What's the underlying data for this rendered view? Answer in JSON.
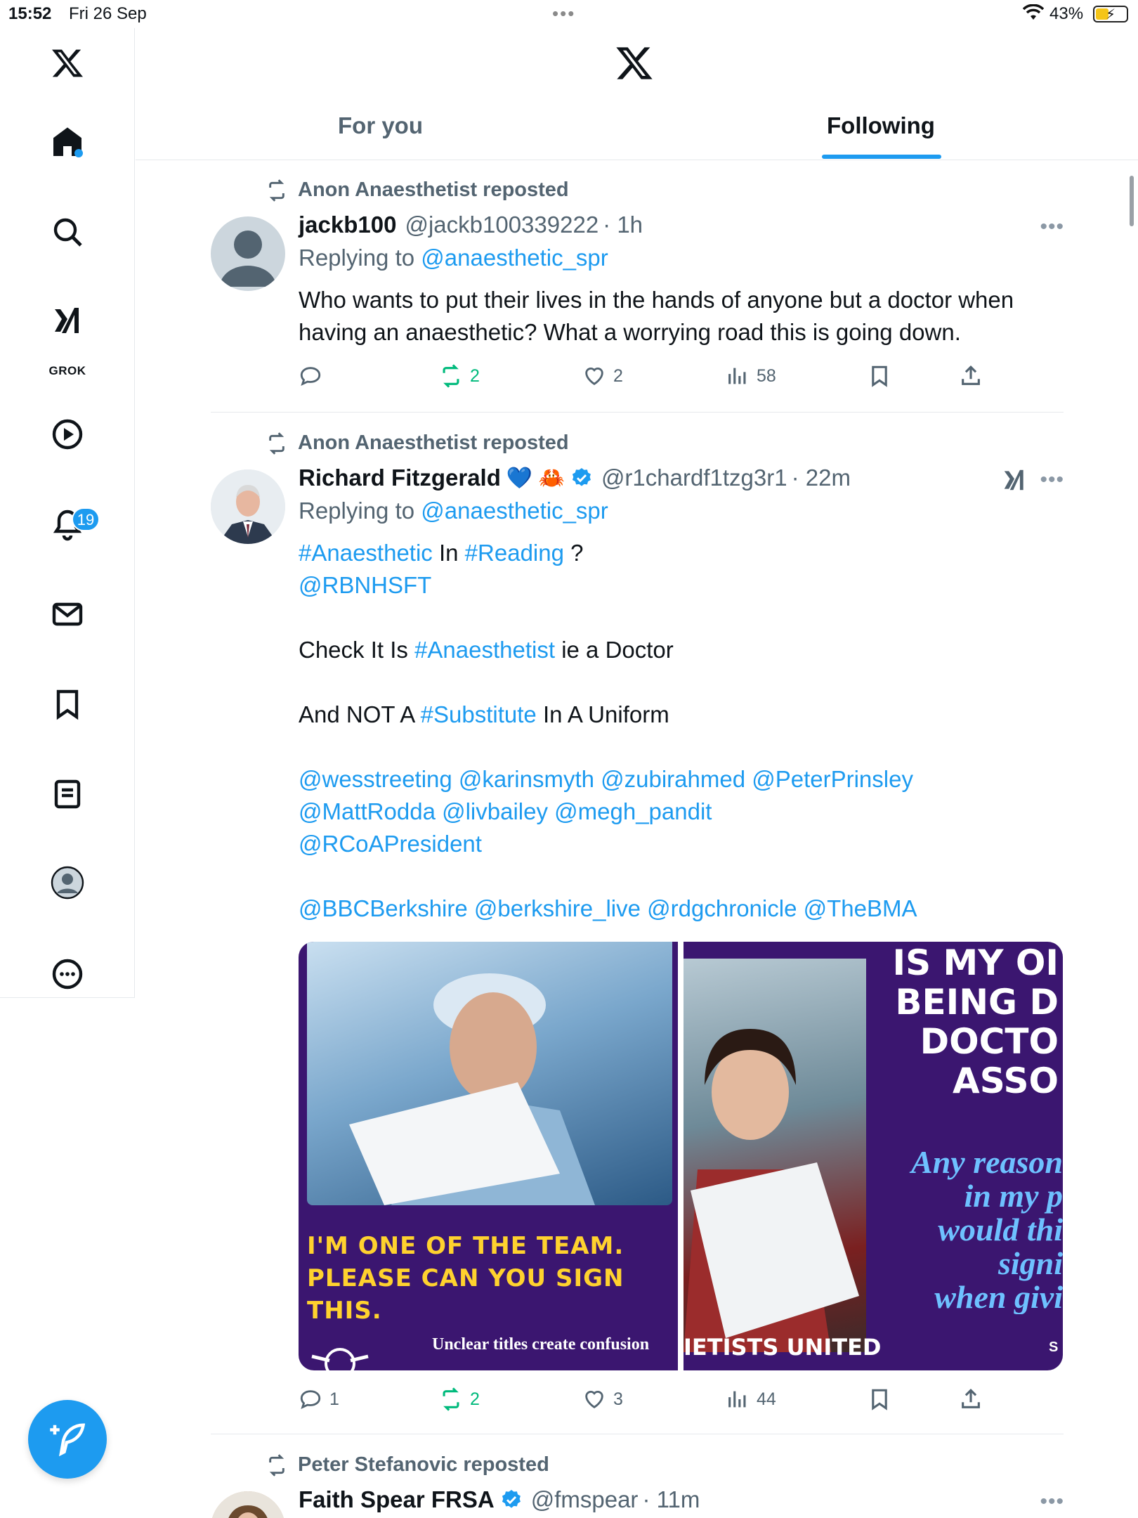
{
  "status_bar": {
    "time": "15:52",
    "date": "Fri 26 Sep",
    "battery": "43%"
  },
  "sidebar": {
    "grok_label": "GROK",
    "notifications_count": "19"
  },
  "header": {
    "tabs": [
      {
        "label": "For you"
      },
      {
        "label": "Following"
      }
    ]
  },
  "tweets": [
    {
      "repost_by": "Anon Anaesthetist reposted",
      "name": "jackb100",
      "handle": "@jackb100339222",
      "time": "· 1h",
      "replying_prefix": "Replying to",
      "replying_to": "@anaesthetic_spr",
      "text": "Who wants to put their lives in the hands of anyone but a doctor when having an anaesthetic? What a worrying road this is going down.",
      "stats": {
        "replies": "",
        "reposts": "2",
        "likes": "2",
        "views": "58"
      }
    },
    {
      "repost_by": "Anon Anaesthetist reposted",
      "name": "Richard Fitzgerald",
      "emoji": "💙 🦀",
      "handle": "@r1chardf1tzg3r1",
      "time": "· 22m",
      "replying_prefix": "Replying to",
      "replying_to": "@anaesthetic_spr",
      "lines": {
        "l1_tag1": "#Anaesthetic",
        "l1_mid": " In ",
        "l1_tag2": "#Reading",
        "l1_end": " ?",
        "l2": "@RBNHSFT",
        "l3_pre": "Check It Is ",
        "l3_tag": "#Anaesthetist",
        "l3_post": " ie a Doctor",
        "l4_pre": "And NOT A ",
        "l4_tag": "#Substitute",
        "l4_post": " In A Uniform",
        "l5": "@wesstreeting @karinsmyth @zubirahmed @PeterPrinsley",
        "l6": "@MattRodda @livbailey @megh_pandit",
        "l7": "@RCoAPresident",
        "l8": "@BBCBerkshire @berkshire_live @rdgchronicle @TheBMA"
      },
      "media": {
        "left_caption_1": "I'M ONE OF THE TEAM.",
        "left_caption_2": "PLEASE CAN YOU SIGN THIS.",
        "left_sub": "Unclear titles create confusion",
        "right_head_1": "IS MY OI",
        "right_head_2": "BEING D",
        "right_head_3": "DOCTO",
        "right_head_4": "ASSO",
        "right_italic_1": "Any reason",
        "right_italic_2": "in my p",
        "right_italic_3": "would thi",
        "right_italic_4": "signi",
        "right_italic_5": "when givi",
        "right_bottom": "IETISTS UNITED",
        "right_s": "S"
      },
      "stats": {
        "replies": "1",
        "reposts": "2",
        "likes": "3",
        "views": "44"
      }
    },
    {
      "repost_by": "Peter Stefanovic reposted",
      "name": "Faith Spear FRSA",
      "handle": "@fmspear",
      "time": "· 11m"
    }
  ],
  "colors": {
    "accent": "#1d9bf0",
    "repost_green": "#00ba7c",
    "muted": "#536471"
  }
}
